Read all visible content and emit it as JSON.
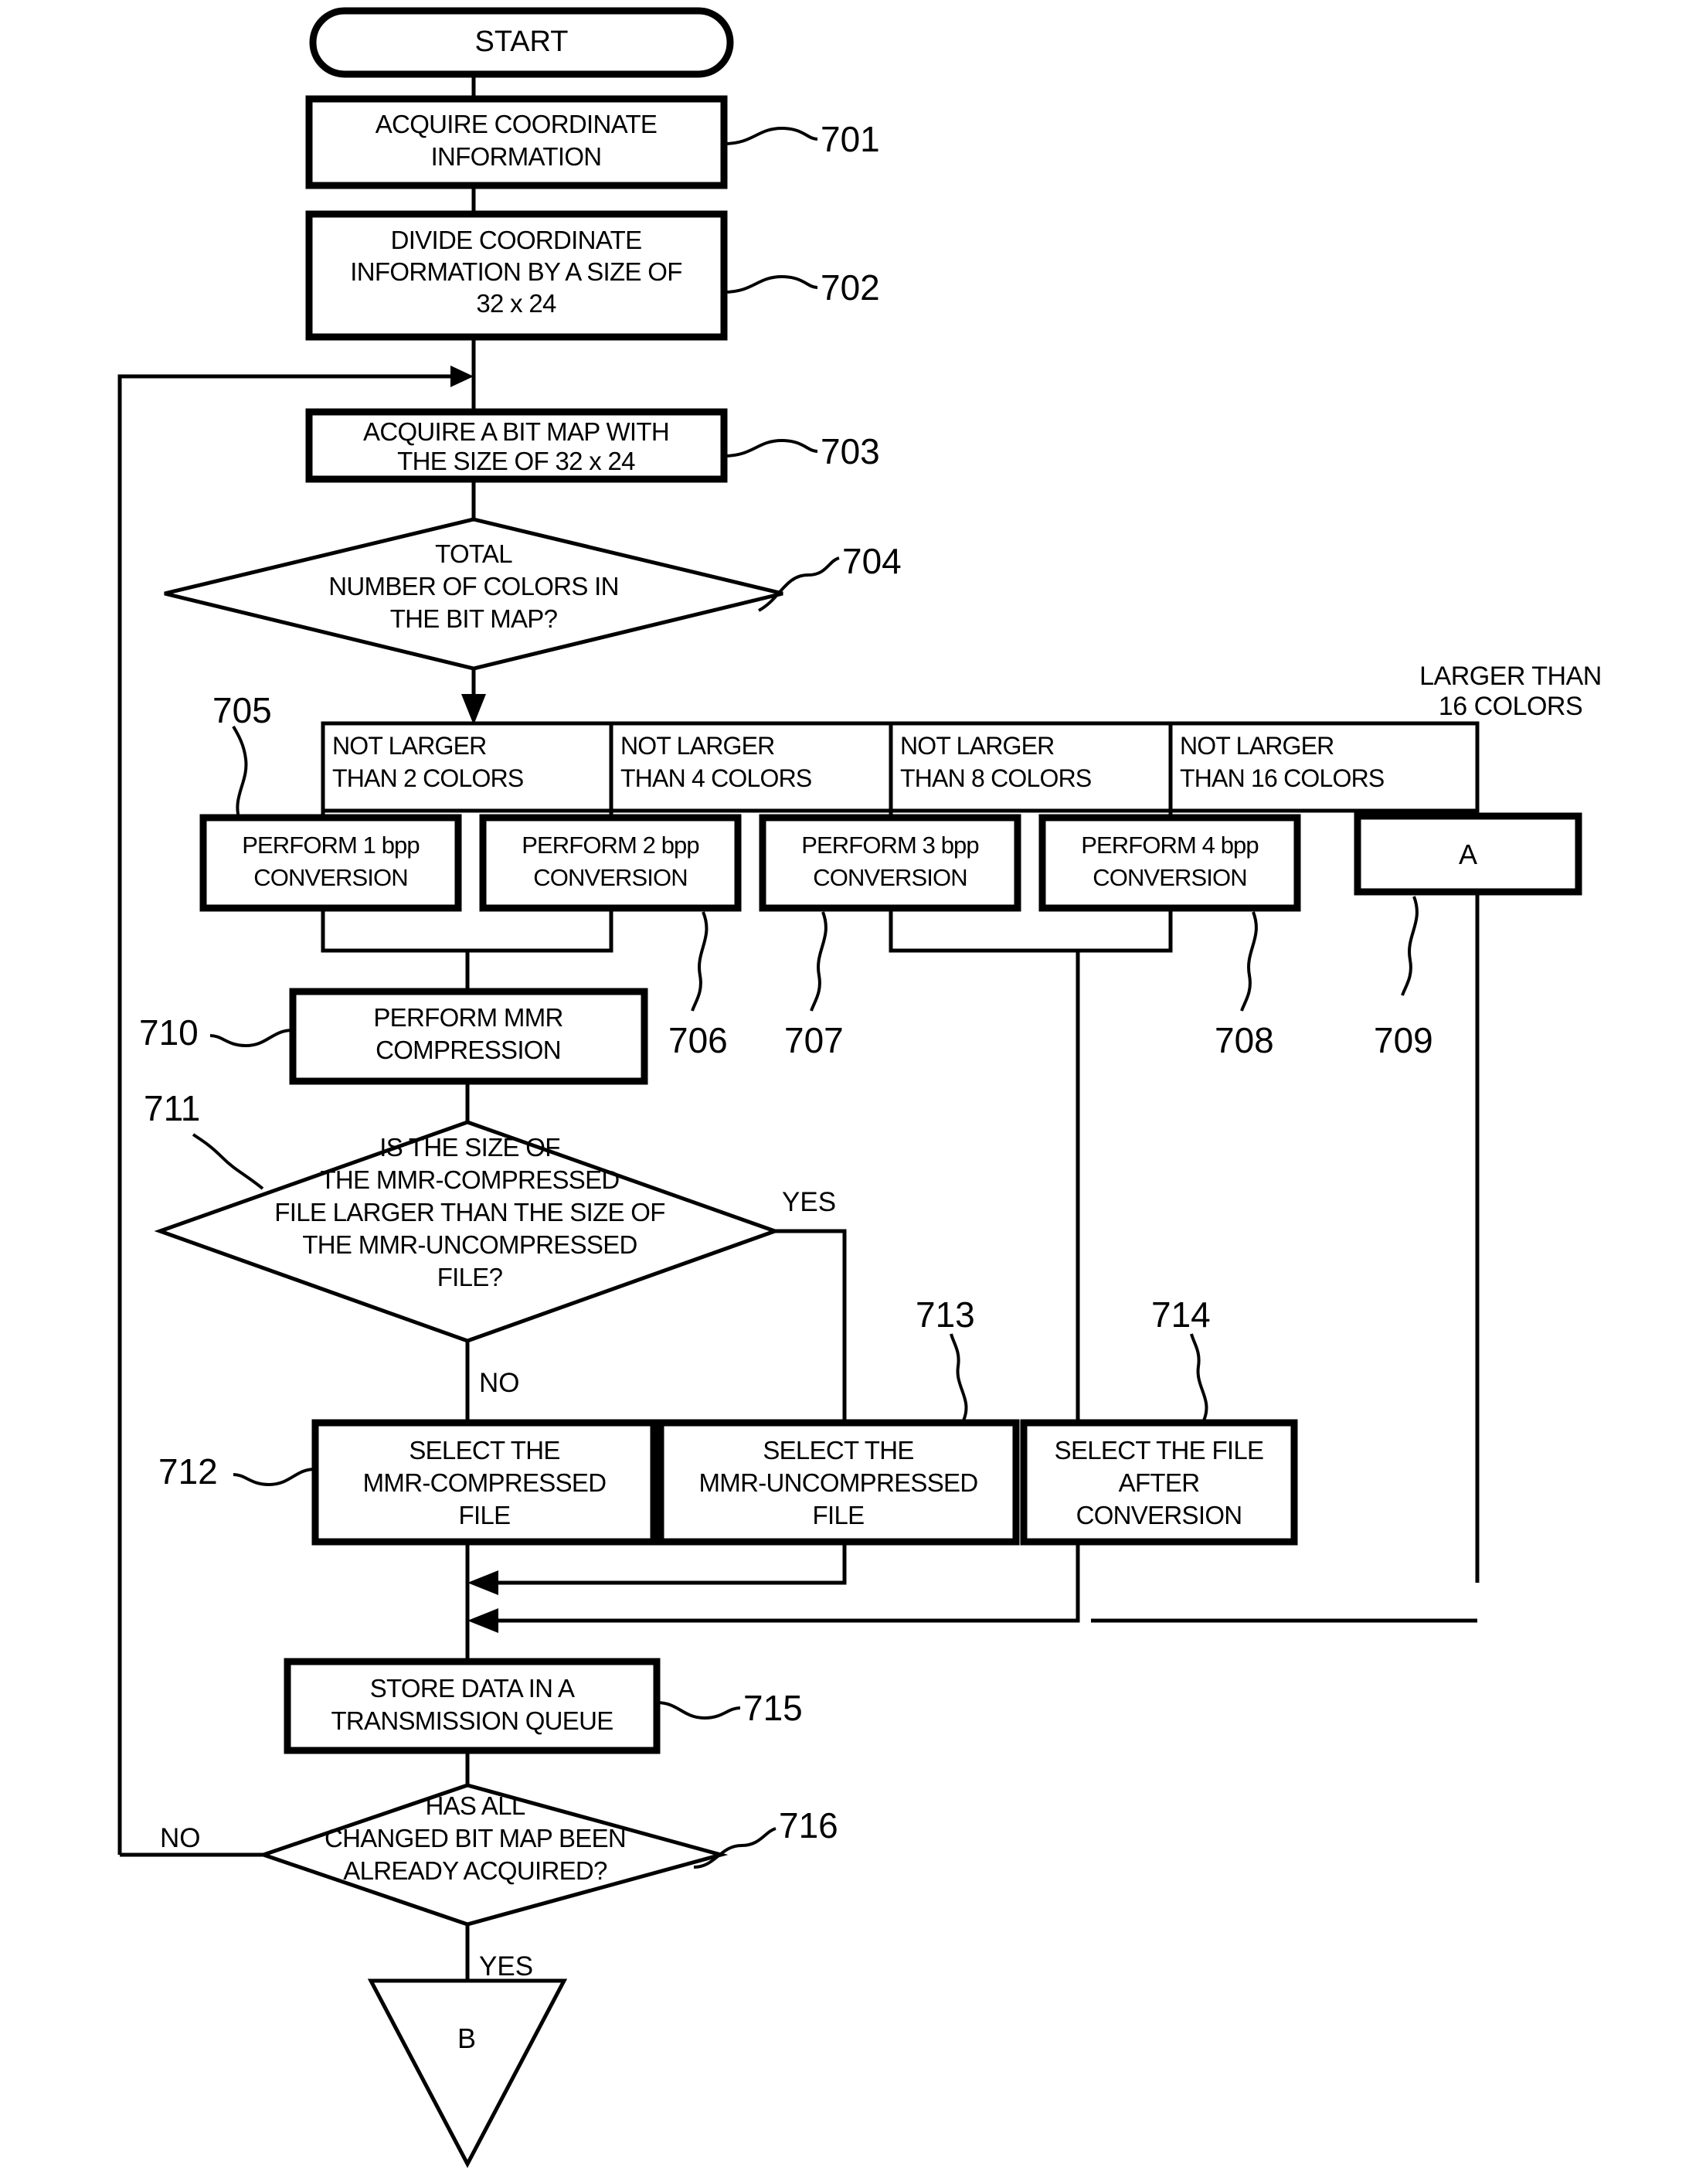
{
  "figure": {
    "type": "patent-flowchart",
    "terminals": {
      "start": "START",
      "connector_a": "A",
      "connector_b": "B"
    },
    "steps": [
      {
        "ref": "701",
        "lines": [
          "ACQUIRE COORDINATE",
          "INFORMATION"
        ]
      },
      {
        "ref": "702",
        "lines": [
          "DIVIDE COORDINATE",
          "INFORMATION BY A SIZE OF",
          "32 x 24"
        ]
      },
      {
        "ref": "703",
        "lines": [
          "ACQUIRE A BIT MAP WITH",
          "THE SIZE OF 32 x 24"
        ]
      },
      {
        "ref": "704",
        "lines": [
          "TOTAL",
          "NUMBER OF COLORS IN",
          "THE BIT MAP?"
        ],
        "kind": "decision"
      },
      {
        "ref": "705",
        "lines": [
          "PERFORM 1 bpp",
          "CONVERSION"
        ]
      },
      {
        "ref": "706",
        "lines": [
          "PERFORM 2 bpp",
          "CONVERSION"
        ]
      },
      {
        "ref": "707",
        "lines": [
          "PERFORM 3 bpp",
          "CONVERSION"
        ]
      },
      {
        "ref": "708",
        "lines": [
          "PERFORM 4 bpp",
          "CONVERSION"
        ]
      },
      {
        "ref": "709",
        "lines": [
          "A"
        ],
        "kind": "connector"
      },
      {
        "ref": "710",
        "lines": [
          "PERFORM MMR",
          "COMPRESSION"
        ]
      },
      {
        "ref": "711",
        "lines": [
          "IS THE SIZE OF",
          "THE MMR-COMPRESSED",
          "FILE LARGER THAN THE SIZE OF",
          "THE MMR-UNCOMPRESSED",
          "FILE?"
        ],
        "kind": "decision"
      },
      {
        "ref": "712",
        "lines": [
          "SELECT THE",
          "MMR-COMPRESSED",
          "FILE"
        ]
      },
      {
        "ref": "713",
        "lines": [
          "SELECT THE",
          "MMR-UNCOMPRESSED",
          "FILE"
        ]
      },
      {
        "ref": "714",
        "lines": [
          "SELECT THE FILE",
          "AFTER",
          "CONVERSION"
        ]
      },
      {
        "ref": "715",
        "lines": [
          "STORE DATA IN A",
          "TRANSMISSION QUEUE"
        ]
      },
      {
        "ref": "716",
        "lines": [
          "HAS ALL",
          "CHANGED BIT MAP BEEN",
          "ALREADY ACQUIRED?"
        ],
        "kind": "decision"
      }
    ],
    "branch_labels": [
      {
        "lines": [
          "NOT LARGER",
          "THAN 2 COLORS"
        ]
      },
      {
        "lines": [
          "NOT LARGER",
          "THAN 4 COLORS"
        ]
      },
      {
        "lines": [
          "NOT LARGER",
          "THAN 8 COLORS"
        ]
      },
      {
        "lines": [
          "NOT LARGER",
          "THAN 16 COLORS"
        ]
      }
    ],
    "outside_label": {
      "lines": [
        "LARGER THAN",
        "16 COLORS"
      ]
    },
    "edge_labels": {
      "yes_711": "YES",
      "no_711": "NO",
      "no_716": "NO",
      "yes_716": "YES"
    },
    "ref_numbers": [
      "701",
      "702",
      "703",
      "704",
      "705",
      "706",
      "707",
      "708",
      "709",
      "710",
      "711",
      "712",
      "713",
      "714",
      "715",
      "716"
    ],
    "colors": {
      "stroke": "#000000",
      "fill": "#ffffff"
    }
  }
}
